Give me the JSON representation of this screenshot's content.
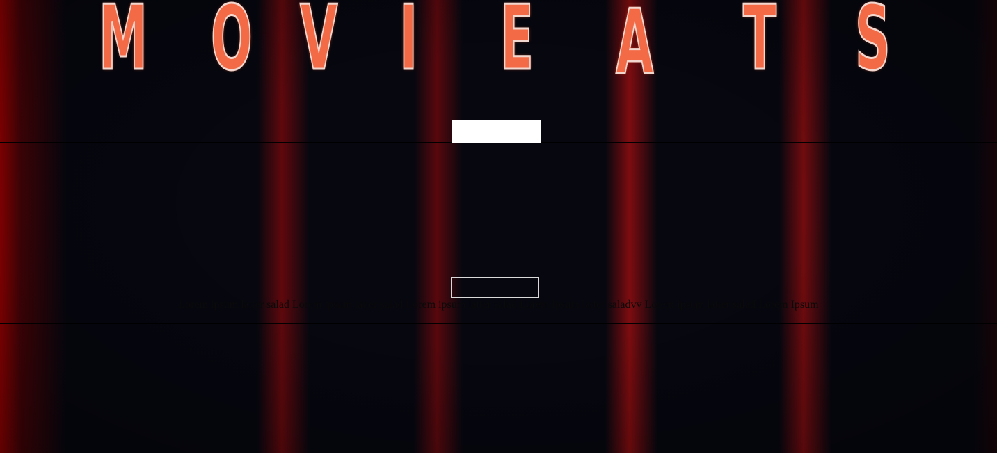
{
  "logo": {
    "letters": [
      "M",
      "O",
      "V",
      "I",
      "E",
      "A",
      "T",
      "S"
    ],
    "color": "#f36a46"
  },
  "hero": {
    "button_label": "",
    "description": "Lorem ipsum latter salad Lorem ipsum latter salad Lorem ipsum latter salad Lorem ipsum latter saladvv Lorem ipsum latter salad Lorem Ipsum"
  },
  "colors": {
    "background": "#06070f",
    "curtain_red": "#b00000",
    "nav_box": "#ffffff"
  }
}
